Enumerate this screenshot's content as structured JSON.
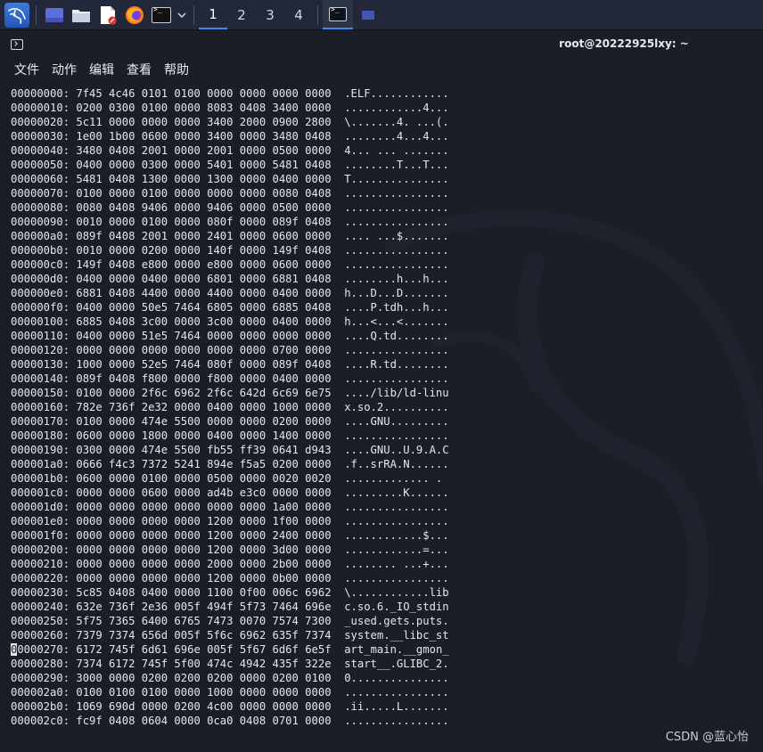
{
  "taskbar": {
    "kali_menu_icon": "kali-dragon-icon",
    "apps": [
      {
        "name": "show-desktop-icon",
        "color": "#5b6fd6"
      },
      {
        "name": "file-manager-icon",
        "color": "#e8ecf2"
      },
      {
        "name": "text-editor-icon",
        "color": "#ffffff"
      },
      {
        "name": "firefox-icon",
        "color": "#ff7a1a"
      },
      {
        "name": "terminal-icon",
        "color": "#111111"
      }
    ],
    "workspaces": [
      "1",
      "2",
      "3",
      "4"
    ],
    "active_workspace": "1"
  },
  "window": {
    "title": "root@20222925lxy: ~"
  },
  "menu": {
    "file": "文件",
    "action": "动作",
    "edit": "编辑",
    "view": "查看",
    "help": "帮助"
  },
  "terminal": {
    "lines": [
      "00000000: 7f45 4c46 0101 0100 0000 0000 0000 0000  .ELF............",
      "00000010: 0200 0300 0100 0000 8083 0408 3400 0000  ............4...",
      "00000020: 5c11 0000 0000 0000 3400 2000 0900 2800  \\.......4. ...(.",
      "00000030: 1e00 1b00 0600 0000 3400 0000 3480 0408  ........4...4...",
      "00000040: 3480 0408 2001 0000 2001 0000 0500 0000  4... ... .......",
      "00000050: 0400 0000 0300 0000 5401 0000 5481 0408  ........T...T...",
      "00000060: 5481 0408 1300 0000 1300 0000 0400 0000  T...............",
      "00000070: 0100 0000 0100 0000 0000 0000 0080 0408  ................",
      "00000080: 0080 0408 9406 0000 9406 0000 0500 0000  ................",
      "00000090: 0010 0000 0100 0000 080f 0000 089f 0408  ................",
      "000000a0: 089f 0408 2001 0000 2401 0000 0600 0000  .... ...$.......",
      "000000b0: 0010 0000 0200 0000 140f 0000 149f 0408  ................",
      "000000c0: 149f 0408 e800 0000 e800 0000 0600 0000  ................",
      "000000d0: 0400 0000 0400 0000 6801 0000 6881 0408  ........h...h...",
      "000000e0: 6881 0408 4400 0000 4400 0000 0400 0000  h...D...D.......",
      "000000f0: 0400 0000 50e5 7464 6805 0000 6885 0408  ....P.tdh...h...",
      "00000100: 6885 0408 3c00 0000 3c00 0000 0400 0000  h...<...<.......",
      "00000110: 0400 0000 51e5 7464 0000 0000 0000 0000  ....Q.td........",
      "00000120: 0000 0000 0000 0000 0000 0000 0700 0000  ................",
      "00000130: 1000 0000 52e5 7464 080f 0000 089f 0408  ....R.td........",
      "00000140: 089f 0408 f800 0000 f800 0000 0400 0000  ................",
      "00000150: 0100 0000 2f6c 6962 2f6c 642d 6c69 6e75  ..../lib/ld-linu",
      "00000160: 782e 736f 2e32 0000 0400 0000 1000 0000  x.so.2..........",
      "00000170: 0100 0000 474e 5500 0000 0000 0200 0000  ....GNU.........",
      "00000180: 0600 0000 1800 0000 0400 0000 1400 0000  ................",
      "00000190: 0300 0000 474e 5500 fb55 ff39 0641 d943  ....GNU..U.9.A.C",
      "000001a0: 0666 f4c3 7372 5241 894e f5a5 0200 0000  .f..srRA.N......",
      "000001b0: 0600 0000 0100 0000 0500 0000 0020 0020  ............. .",
      "000001c0: 0000 0000 0600 0000 ad4b e3c0 0000 0000  .........K......",
      "000001d0: 0000 0000 0000 0000 0000 0000 1a00 0000  ................",
      "000001e0: 0000 0000 0000 0000 1200 0000 1f00 0000  ................",
      "000001f0: 0000 0000 0000 0000 1200 0000 2400 0000  ............$...",
      "00000200: 0000 0000 0000 0000 1200 0000 3d00 0000  ............=...",
      "00000210: 0000 0000 0000 0000 2000 0000 2b00 0000  ........ ...+...",
      "00000220: 0000 0000 0000 0000 1200 0000 0b00 0000  ................",
      "00000230: 5c85 0408 0400 0000 1100 0f00 006c 6962  \\............lib",
      "00000240: 632e 736f 2e36 005f 494f 5f73 7464 696e  c.so.6._IO_stdin",
      "00000250: 5f75 7365 6400 6765 7473 0070 7574 7300  _used.gets.puts.",
      "00000260: 7379 7374 656d 005f 5f6c 6962 635f 7374  system.__libc_st",
      "00000270: 6172 745f 6d61 696e 005f 5f67 6d6f 6e5f  art_main.__gmon_",
      "00000280: 7374 6172 745f 5f00 474c 4942 435f 322e  start__.GLIBC_2.",
      "00000290: 3000 0000 0200 0200 0200 0000 0200 0100  0...............",
      "000002a0: 0100 0100 0100 0000 1000 0000 0000 0000  ................",
      "000002b0: 1069 690d 0000 0200 4c00 0000 0000 0000  .ii.....L.......",
      "000002c0: fc9f 0408 0604 0000 0ca0 0408 0701 0000  ................"
    ],
    "cursor_line_index": 39
  },
  "watermark": "CSDN @蓝心怡",
  "colors": {
    "taskbar_bg": "#22283a",
    "terminal_bg": "#1b1e27",
    "accent": "#3b8cf2",
    "text": "#e4e7ec"
  }
}
